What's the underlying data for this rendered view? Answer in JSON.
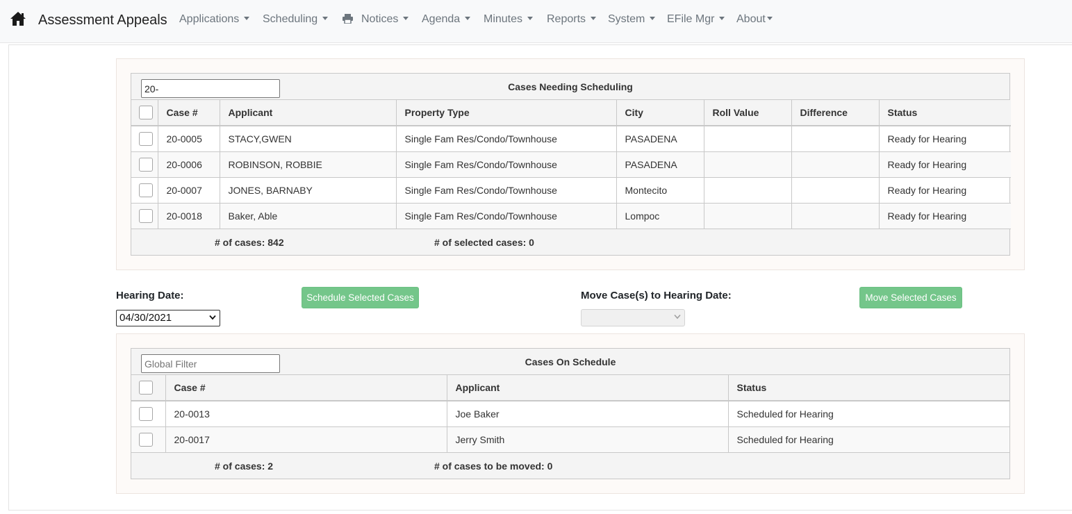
{
  "navbar": {
    "brand": "Assessment Appeals",
    "items": [
      {
        "label": "Applications"
      },
      {
        "label": "Scheduling"
      },
      {
        "label": "Notices"
      },
      {
        "label": "Agenda"
      },
      {
        "label": "Minutes"
      },
      {
        "label": "Reports"
      },
      {
        "label": "System"
      },
      {
        "label": "EFile Mgr"
      },
      {
        "label": "About"
      }
    ]
  },
  "needing": {
    "filter_value": "20-",
    "title": "Cases Needing Scheduling",
    "columns": [
      "Case #",
      "Applicant",
      "Property Type",
      "City",
      "Roll Value",
      "Difference",
      "Status"
    ],
    "rows": [
      {
        "case": "20-0005",
        "applicant": "STACY,GWEN",
        "property_type": "Single Fam Res/Condo/Townhouse",
        "city": "PASADENA",
        "roll_value": "",
        "difference": "",
        "status": "Ready for Hearing"
      },
      {
        "case": "20-0006",
        "applicant": "ROBINSON, ROBBIE",
        "property_type": "Single Fam Res/Condo/Townhouse",
        "city": "PASADENA",
        "roll_value": "",
        "difference": "",
        "status": "Ready for Hearing"
      },
      {
        "case": "20-0007",
        "applicant": "JONES, BARNABY",
        "property_type": "Single Fam Res/Condo/Townhouse",
        "city": "Montecito",
        "roll_value": "",
        "difference": "",
        "status": "Ready for Hearing"
      },
      {
        "case": "20-0018",
        "applicant": "Baker, Able",
        "property_type": "Single Fam Res/Condo/Townhouse",
        "city": "Lompoc",
        "roll_value": "",
        "difference": "",
        "status": "Ready for Hearing"
      }
    ],
    "footer_count": "# of cases: 842",
    "footer_selected": "# of selected cases: 0"
  },
  "controls": {
    "hearing_date_label": "Hearing Date:",
    "hearing_date_value": "04/30/2021",
    "schedule_button": "Schedule Selected Cases",
    "move_label": "Move Case(s) to Hearing Date:",
    "move_value": "",
    "move_button": "Move Selected Cases"
  },
  "onschedule": {
    "filter_placeholder": "Global Filter",
    "title": "Cases On Schedule",
    "columns": [
      "Case #",
      "Applicant",
      "Status"
    ],
    "rows": [
      {
        "case": "20-0013",
        "applicant": "Joe Baker",
        "status": "Scheduled for Hearing"
      },
      {
        "case": "20-0017",
        "applicant": "Jerry Smith",
        "status": "Scheduled for Hearing"
      }
    ],
    "footer_count": "# of cases: 2",
    "footer_moved": "# of cases to be moved: 0"
  },
  "colors": {
    "accent_green": "#74c68a",
    "navbar_bg": "#f8f9fa",
    "nav_text": "#6c757d"
  },
  "icons": [
    "home-icon",
    "printer-icon",
    "chevron-down-icon"
  ]
}
